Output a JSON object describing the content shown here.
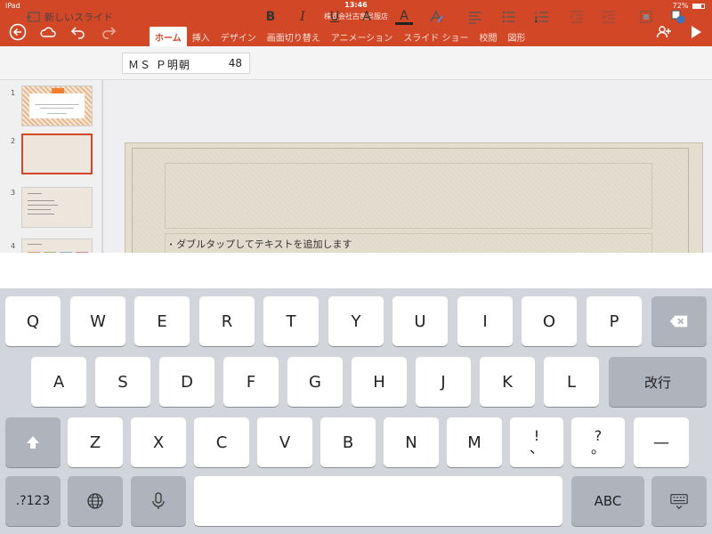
{
  "status_bar": {
    "carrier": "iPad",
    "time": "13:46",
    "battery": "72%"
  },
  "document": {
    "title": "株式会社古竜呉服店"
  },
  "header": {
    "icons": [
      "back-icon",
      "cloud-icon",
      "undo-icon",
      "redo-icon",
      "share-person-icon",
      "play-icon"
    ],
    "tabs": [
      {
        "label": "ホーム",
        "active": true
      },
      {
        "label": "挿入"
      },
      {
        "label": "デザイン"
      },
      {
        "label": "画面切り替え"
      },
      {
        "label": "アニメーション"
      },
      {
        "label": "スライド ショー"
      },
      {
        "label": "校閲"
      },
      {
        "label": "図形"
      }
    ]
  },
  "ribbon": {
    "new_slide_label": "新しいスライド",
    "font_name": "ＭＳ Ｐ明朝",
    "font_size": "48",
    "bold": "B",
    "italic": "I",
    "underline": "U",
    "clear_format": "A",
    "font_color": "A"
  },
  "slides": {
    "numbers": [
      "1",
      "2",
      "3",
      "4"
    ],
    "selected": 2
  },
  "slide": {
    "body_placeholder": "ダブルタップしてテキストを追加します"
  },
  "keyboard": {
    "row1": [
      "Q",
      "W",
      "E",
      "R",
      "T",
      "Y",
      "U",
      "I",
      "O",
      "P"
    ],
    "row2": [
      "A",
      "S",
      "D",
      "F",
      "G",
      "H",
      "J",
      "K",
      "L"
    ],
    "return_label": "改行",
    "row3": [
      "Z",
      "X",
      "C",
      "V",
      "B",
      "N",
      "M"
    ],
    "punct1_top": "!",
    "punct1_bottom": "、",
    "punct2_top": "?",
    "punct2_bottom": "。",
    "dash": "—",
    "numbers_label": ".?123",
    "abc_label": "ABC"
  },
  "colors": {
    "accent": "#d24726",
    "ribbon": "#f4f4f4",
    "keyboard": "#d2d5db"
  }
}
